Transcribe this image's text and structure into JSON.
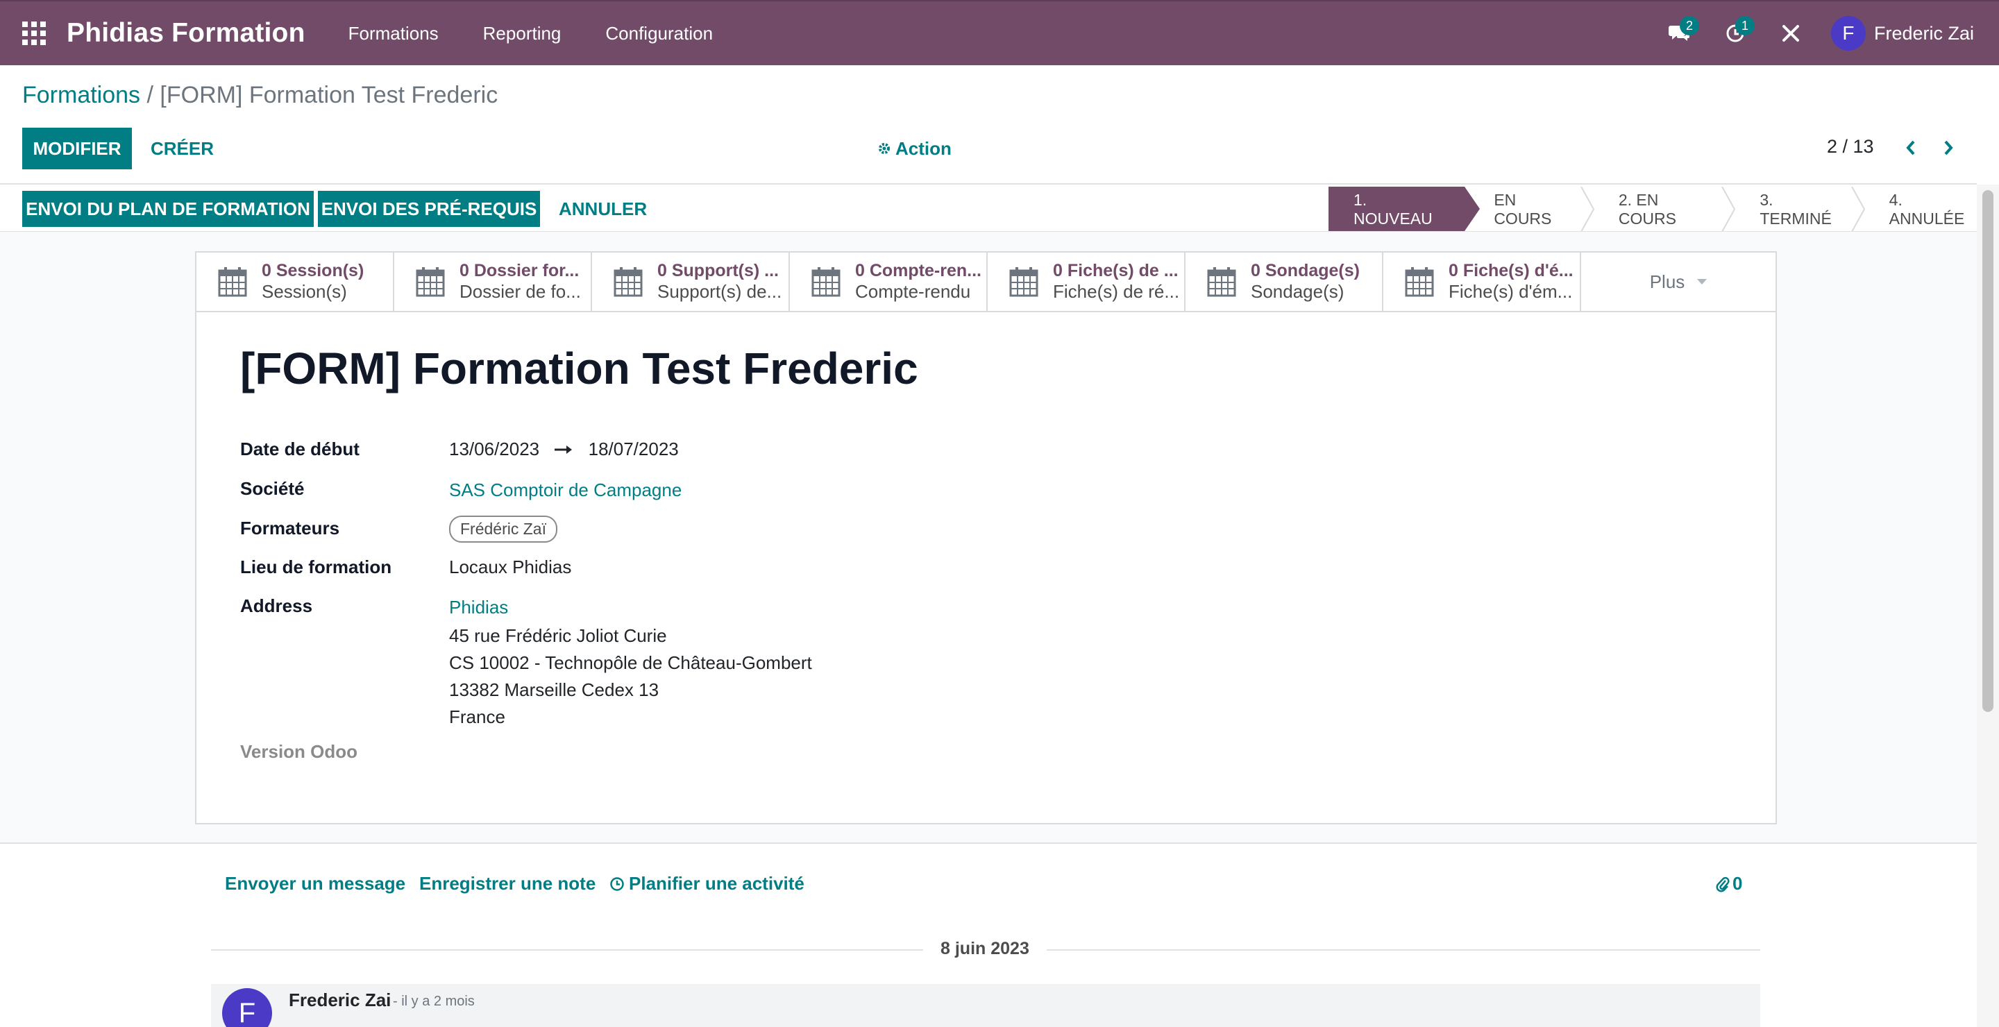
{
  "navbar": {
    "brand": "Phidias Formation",
    "menu": [
      "Formations",
      "Reporting",
      "Configuration"
    ],
    "messages_badge": "2",
    "activities_badge": "1",
    "user_initial": "F",
    "user_name": "Frederic Zai"
  },
  "breadcrumb": {
    "parent": "Formations",
    "separator": " / ",
    "current": "[FORM] Formation Test Frederic"
  },
  "toolbar": {
    "edit": "MODIFIER",
    "create": "CRÉER",
    "action": "Action",
    "pager": "2 / 13"
  },
  "header_buttons": {
    "send_plan": "ENVOI DU PLAN DE FORMATION",
    "send_prereq": "ENVOI DES PRÉ-REQUIS",
    "cancel": "ANNULER"
  },
  "statusbar": [
    "1. NOUVEAU",
    "EN COURS",
    "2. EN COURS",
    "3. TERMINÉ",
    "4. ANNULÉE"
  ],
  "smart_buttons": [
    {
      "value": "0 Session(s)",
      "label": "Session(s)"
    },
    {
      "value": "0 Dossier for...",
      "label": "Dossier de fo..."
    },
    {
      "value": "0 Support(s) ...",
      "label": "Support(s) de..."
    },
    {
      "value": "0 Compte-ren...",
      "label": "Compte-rendu"
    },
    {
      "value": "0 Fiche(s) de ...",
      "label": "Fiche(s) de ré..."
    },
    {
      "value": "0 Sondage(s)",
      "label": "Sondage(s)"
    },
    {
      "value": "0 Fiche(s) d'é...",
      "label": "Fiche(s) d'ém..."
    }
  ],
  "smart_more": "Plus",
  "record": {
    "title": "[FORM] Formation Test Frederic",
    "date_label": "Date de début",
    "date_start": "13/06/2023",
    "date_end": "18/07/2023",
    "company_label": "Société",
    "company": "SAS Comptoir de Campagne",
    "trainers_label": "Formateurs",
    "trainer_tag": "Frédéric Zaï",
    "location_label": "Lieu de formation",
    "location": "Locaux Phidias",
    "address_label": "Address",
    "address_name": "Phidias",
    "address_lines": [
      "45 rue Frédéric Joliot Curie",
      "CS 10002 - Technopôle de Château-Gombert",
      "13382 Marseille Cedex 13",
      "France"
    ],
    "odoo_version_label": "Version Odoo"
  },
  "chatter": {
    "send_message": "Envoyer un message",
    "log_note": "Enregistrer une note",
    "schedule_activity": "Planifier une activité",
    "attachments": "0",
    "date_separator": "8 juin 2023",
    "message_author": "Frederic Zai",
    "message_time": "- il y a 2 mois",
    "message_initial": "F"
  },
  "colors": {
    "brand": "#714b67",
    "primary": "#017e84"
  }
}
